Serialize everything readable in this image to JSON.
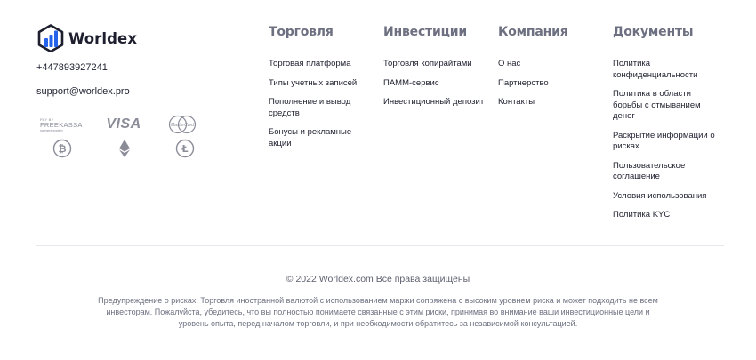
{
  "brand": {
    "name": "Worldex",
    "phone": "+447893927241",
    "email": "support@worldex.pro",
    "accent_color": "#2563eb"
  },
  "payments": {
    "freekassa": {
      "pay_by": "PAY BY",
      "name": "FREEKASSA",
      "sub": "payment system"
    },
    "visa": "VISA",
    "mastercard": "MasterCard",
    "crypto_icons": [
      "bitcoin-icon",
      "ethereum-icon",
      "litecoin-icon"
    ]
  },
  "columns": {
    "trade": {
      "title": "Торговля",
      "links": [
        "Торговая платформа",
        "Типы учетных записей",
        "Пополнение и вывод средств",
        "Бонусы и рекламные акции"
      ]
    },
    "invest": {
      "title": "Инвестиции",
      "links": [
        "Торговля копирайтами",
        "ПАММ-сервис",
        "Инвестиционный депозит"
      ]
    },
    "company": {
      "title": "Компания",
      "links": [
        "О нас",
        "Партнерство",
        "Контакты"
      ]
    },
    "docs": {
      "title": "Документы",
      "links": [
        "Политика конфиденциальности",
        "Политика в области борьбы с отмыванием денег",
        "Раскрытие информации о рисках",
        "Пользовательское соглашение",
        "Условия использования",
        "Политика KYC"
      ]
    }
  },
  "footer": {
    "copyright": "© 2022 Worldex.com Все права защищены",
    "risk_warning": "Предупреждение о рисках: Торговля иностранной валютой с использованием маржи сопряжена с высоким уровнем риска и может подходить не всем инвесторам. Пожалуйста, убедитесь, что вы полностью понимаете связанные с этим риски, принимая во внимание ваши инвестиционные цели и уровень опыта, перед началом торговли, и при необходимости обратитесь за независимой консультацией."
  }
}
